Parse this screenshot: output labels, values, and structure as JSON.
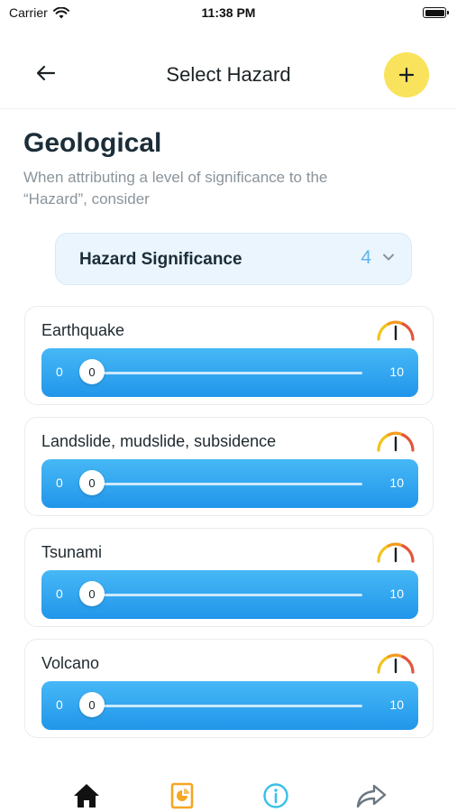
{
  "status_bar": {
    "carrier": "Carrier",
    "time": "11:38 PM"
  },
  "header": {
    "title": "Select Hazard"
  },
  "section": {
    "title": "Geological",
    "description": "When attributing a level of significance to the “Hazard”, consider"
  },
  "significance": {
    "label": "Hazard Significance",
    "value": "4"
  },
  "hazards": [
    {
      "name": "Earthquake",
      "min": "0",
      "max": "10",
      "value": "0"
    },
    {
      "name": "Landslide, mudslide, subsidence",
      "min": "0",
      "max": "10",
      "value": "0"
    },
    {
      "name": "Tsunami",
      "min": "0",
      "max": "10",
      "value": "0"
    },
    {
      "name": "Volcano",
      "min": "0",
      "max": "10",
      "value": "0"
    }
  ],
  "tabbar": {
    "items": [
      {
        "icon": "home-icon",
        "color": "#111111"
      },
      {
        "icon": "document-chart-icon",
        "color": "#f5a623"
      },
      {
        "icon": "info-icon",
        "color": "#3ac0e6"
      },
      {
        "icon": "share-icon",
        "color": "#6b7780"
      }
    ]
  },
  "colors": {
    "accent": "#f9e35d",
    "slider": "#2f9fef",
    "significance_value": "#5db4ec"
  }
}
